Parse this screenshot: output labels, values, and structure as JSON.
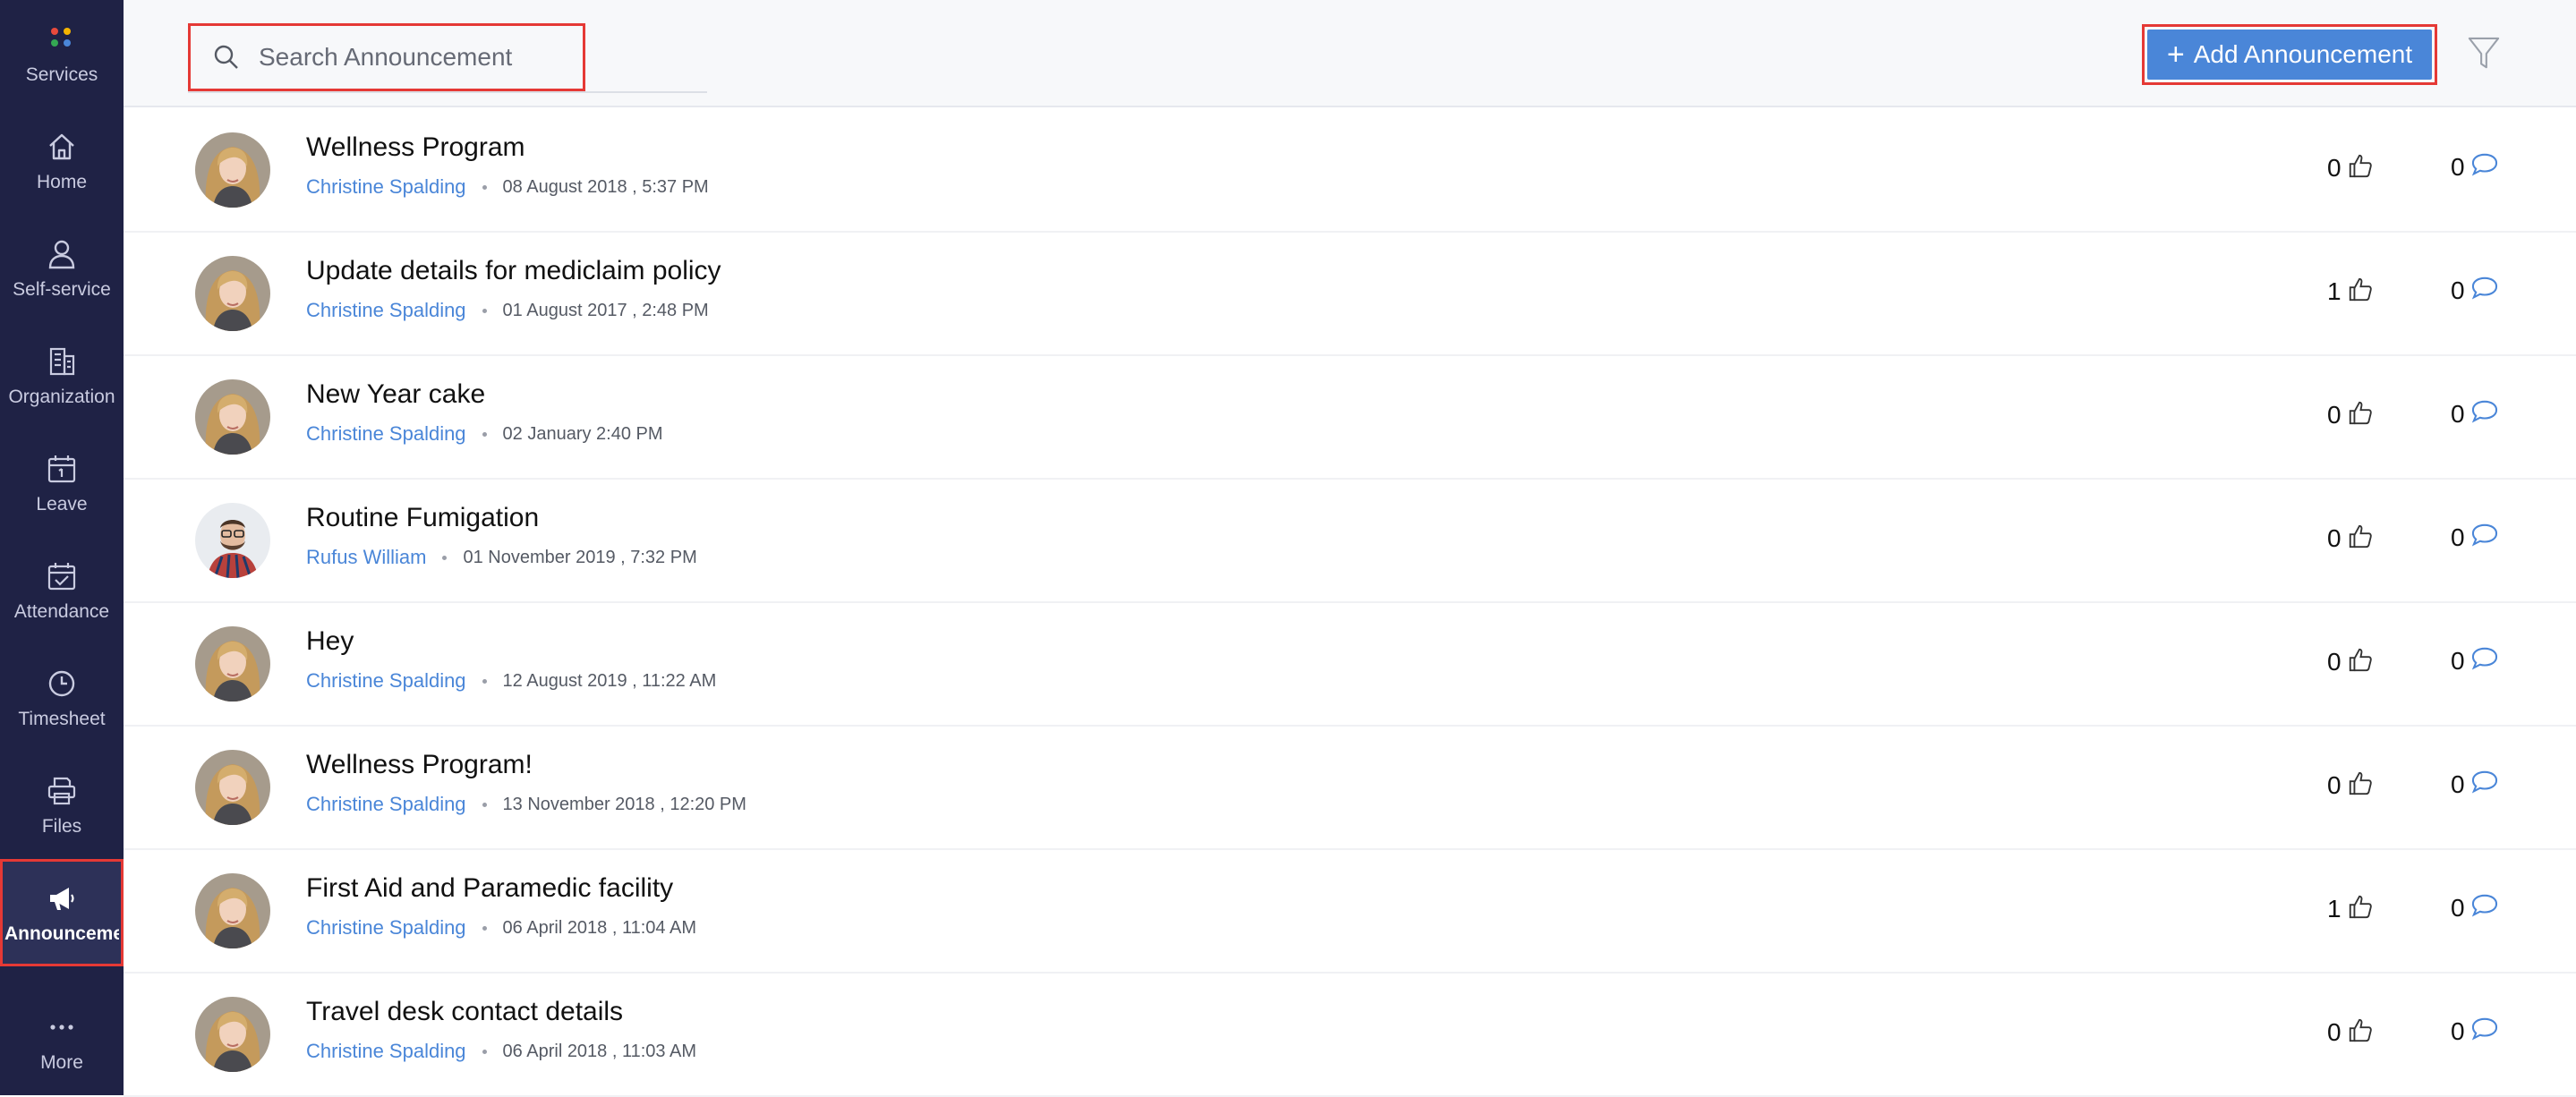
{
  "sidebar": {
    "items": [
      {
        "label": "Services",
        "icon": "services-dots-icon"
      },
      {
        "label": "Home",
        "icon": "home-icon"
      },
      {
        "label": "Self-service",
        "icon": "user-icon"
      },
      {
        "label": "Organization",
        "icon": "building-icon"
      },
      {
        "label": "Leave",
        "icon": "calendar-icon"
      },
      {
        "label": "Attendance",
        "icon": "calendar-check-icon"
      },
      {
        "label": "Timesheet",
        "icon": "clock-icon"
      },
      {
        "label": "Files",
        "icon": "printer-icon"
      },
      {
        "label": "Announceme",
        "icon": "megaphone-icon",
        "active": true
      },
      {
        "label": "More",
        "icon": "more-dots-icon"
      }
    ]
  },
  "header": {
    "search_placeholder": "Search Announcement",
    "add_button_label": "Add Announcement",
    "accent_color": "#4a86d8",
    "highlight_color": "#e53935"
  },
  "announcements": [
    {
      "title": "Wellness Program",
      "author": "Christine Spalding",
      "date": "08 August 2018 , 5:37 PM",
      "likes": "0",
      "comments": "0",
      "avatar": "female"
    },
    {
      "title": "Update details for mediclaim policy",
      "author": "Christine Spalding",
      "date": "01 August 2017 , 2:48 PM",
      "likes": "1",
      "comments": "0",
      "avatar": "female"
    },
    {
      "title": "New Year cake",
      "author": "Christine Spalding",
      "date": "02 January 2:40 PM",
      "likes": "0",
      "comments": "0",
      "avatar": "female"
    },
    {
      "title": "Routine Fumigation",
      "author": "Rufus William",
      "date": "01 November 2019 , 7:32 PM",
      "likes": "0",
      "comments": "0",
      "avatar": "male"
    },
    {
      "title": "Hey",
      "author": "Christine Spalding",
      "date": "12 August 2019 , 11:22 AM",
      "likes": "0",
      "comments": "0",
      "avatar": "female"
    },
    {
      "title": "Wellness Program!",
      "author": "Christine Spalding",
      "date": "13 November 2018 , 12:20 PM",
      "likes": "0",
      "comments": "0",
      "avatar": "female"
    },
    {
      "title": "First Aid and Paramedic facility",
      "author": "Christine Spalding",
      "date": "06 April 2018 , 11:04 AM",
      "likes": "1",
      "comments": "0",
      "avatar": "female"
    },
    {
      "title": "Travel desk contact details",
      "author": "Christine Spalding",
      "date": "06 April 2018 , 11:03 AM",
      "likes": "0",
      "comments": "0",
      "avatar": "female"
    }
  ]
}
